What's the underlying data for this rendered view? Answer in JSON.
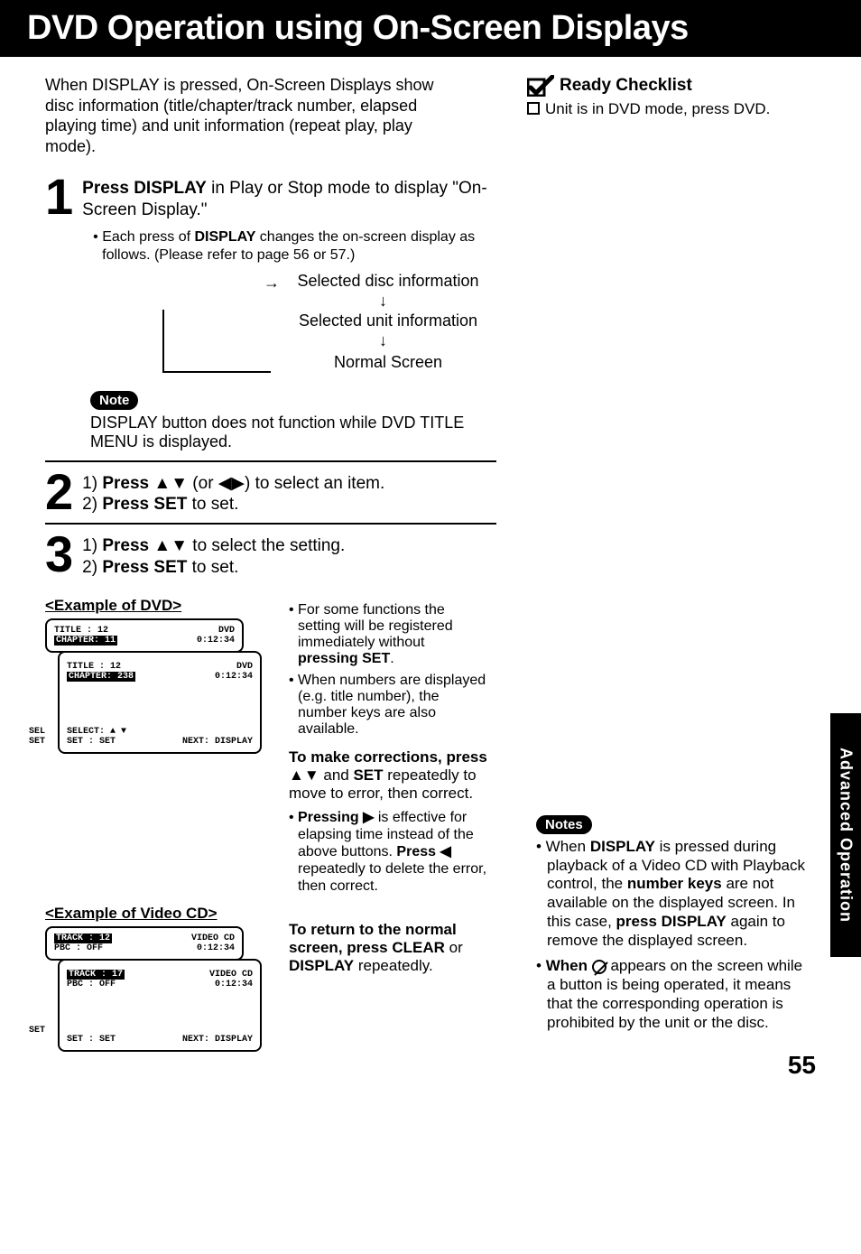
{
  "header_title": "DVD Operation using On-Screen Displays",
  "intro": "When DISPLAY is pressed, On-Screen Displays show disc information (title/chapter/track number, elapsed playing time) and unit information (repeat play, play mode).",
  "checklist": {
    "title": "Ready Checklist",
    "item1": "Unit is in DVD mode, press DVD."
  },
  "step1": {
    "line_a": "Press DISPLAY",
    "line_b": " in Play or Stop mode to display \"On-Screen Display.\"",
    "bullet_a": "• Each press of ",
    "bullet_b": "DISPLAY",
    "bullet_c": " changes the on-screen display as follows. (Please refer to page 56 or 57.)"
  },
  "flow": {
    "t1": "Selected disc information",
    "t2": "Selected unit information",
    "t3": "Normal Screen"
  },
  "note_label": "Note",
  "note_text": "DISPLAY button does not function while DVD TITLE MENU is displayed.",
  "step2": {
    "l1a": "1) ",
    "l1b": "Press ▲▼",
    "l1c": " (or ◀▶) to select an item.",
    "l2a": "2) ",
    "l2b": "Press SET",
    "l2c": " to set."
  },
  "step3": {
    "l1a": "1) ",
    "l1b": "Press ▲▼",
    "l1c": " to select the setting.",
    "l2a": "2) ",
    "l2b": "Press SET",
    "l2c": " to set."
  },
  "ex_dvd": {
    "header": "<Example of DVD>",
    "top": {
      "title": "TITLE    : 12",
      "chapter": "CHAPTER: 11",
      "dvd": "DVD",
      "time": "0:12:34"
    },
    "inner": {
      "title": "TITLE    : 12",
      "chapter": "CHAPTER: 238",
      "dvd": "DVD",
      "time": "0:12:34",
      "sel": "SELECT: ▲ ▼",
      "set": "SET      : SET",
      "next": "NEXT: DISPLAY"
    },
    "side": "SEL\nSET"
  },
  "ex_vcd": {
    "header": "<Example of Video CD>",
    "top": {
      "track": "TRACK  : 12",
      "pbc": "PBC       : OFF",
      "vcd": "VIDEO CD",
      "time": "0:12:34"
    },
    "inner": {
      "track": "TRACK  : 17",
      "pbc": "PBC       : OFF",
      "vcd": "VIDEO CD",
      "time": "0:12:34",
      "set": "SET      : SET",
      "next": "NEXT: DISPLAY"
    },
    "side": "SET"
  },
  "right_bullets": {
    "b1": "• For some functions the setting will be registered immediately without ",
    "b1b": "pressing SET",
    "b1c": ".",
    "b2": "• When numbers are displayed (e.g. title number), the number keys are also available."
  },
  "corrections": {
    "h": "To make corrections, press ▲▼",
    "h2": " and ",
    "h3": "SET",
    "t": " repeatedly to move to error, then correct.",
    "sb1a": "• ",
    "sb1b": "Pressing ▶",
    "sb1c": " is effective for elapsing time instead of the above buttons. ",
    "sb1d": "Press ◀",
    "sb1e": " repeatedly to delete the error, then correct."
  },
  "return_block": {
    "l1": "To return to the normal screen, press CLEAR",
    "l2": " or ",
    "l3": "DISPLAY",
    "l4": " repeatedly."
  },
  "notes_label": "Notes",
  "notes": {
    "n1a": "• When ",
    "n1b": "DISPLAY",
    "n1c": " is pressed during playback of a Video CD with Playback control, the ",
    "n1d": "number keys",
    "n1e": " are not available on the displayed screen. In this case, ",
    "n1f": "press DISPLAY",
    "n1g": " again to remove the displayed screen.",
    "n2a": "• ",
    "n2b": "When",
    "n2c": " appears on the screen while a button is being operated, it means that the corresponding operation is prohibited by the unit or the disc."
  },
  "side_tab": "Advanced Operation",
  "page_number": "55"
}
